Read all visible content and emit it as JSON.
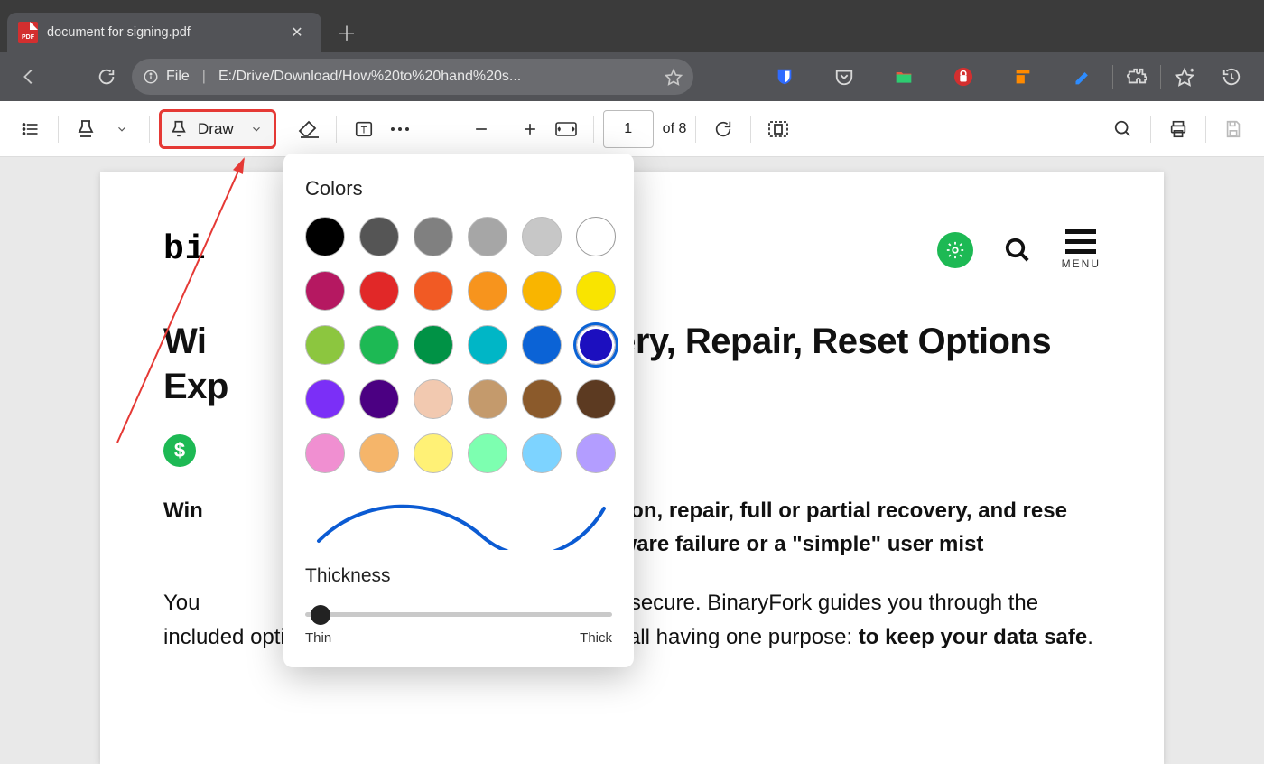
{
  "browser": {
    "tab_title": "document for signing.pdf",
    "url_label": "File",
    "url_path": "E:/Drive/Download/How%20to%20hand%20s...",
    "extensions": [
      "bitwarden",
      "pocket",
      "folder",
      "lastpass",
      "adobe",
      "pen",
      "puzzle",
      "collections",
      "history"
    ]
  },
  "toolbar": {
    "draw_label": "Draw",
    "page_current": "1",
    "page_total_label": "of 8"
  },
  "popover": {
    "colors_label": "Colors",
    "thickness_label": "Thickness",
    "thin_label": "Thin",
    "thick_label": "Thick",
    "selected_index": 17,
    "swatches": [
      "#000000",
      "#555555",
      "#808080",
      "#a6a6a6",
      "#c7c7c7",
      "#ffffff",
      "#b51861",
      "#e12828",
      "#f15a24",
      "#f7941d",
      "#f9b500",
      "#f9e400",
      "#8cc63f",
      "#1db954",
      "#009245",
      "#00b6c6",
      "#0b63d6",
      "#1c0fbf",
      "#7b2ff7",
      "#4b0082",
      "#f2c9b0",
      "#c49a6c",
      "#8b5a2b",
      "#5c3a21",
      "#f08fd1",
      "#f5b56a",
      "#fff176",
      "#7dffb0",
      "#7dd3ff",
      "#b39dff"
    ]
  },
  "document": {
    "logo_fragment": "bi",
    "menu_label": "MENU",
    "title_before": "Wi",
    "title_after": " Recovery, Repair, Reset Options Exp",
    "p1_before": "Win",
    "p1_mid": "ties for restoration, repair, full or partial recovery, and rese",
    "p1_after": "er a catastrophic hardware failure or a \"simple\" user mist",
    "p2_before": "You",
    "p2_mid": "ep your data secure. BinaryFork guides you through the included options available right inside Windows, all having one purpose: ",
    "p2_bold": "to keep your data safe",
    "p2_end": "."
  }
}
